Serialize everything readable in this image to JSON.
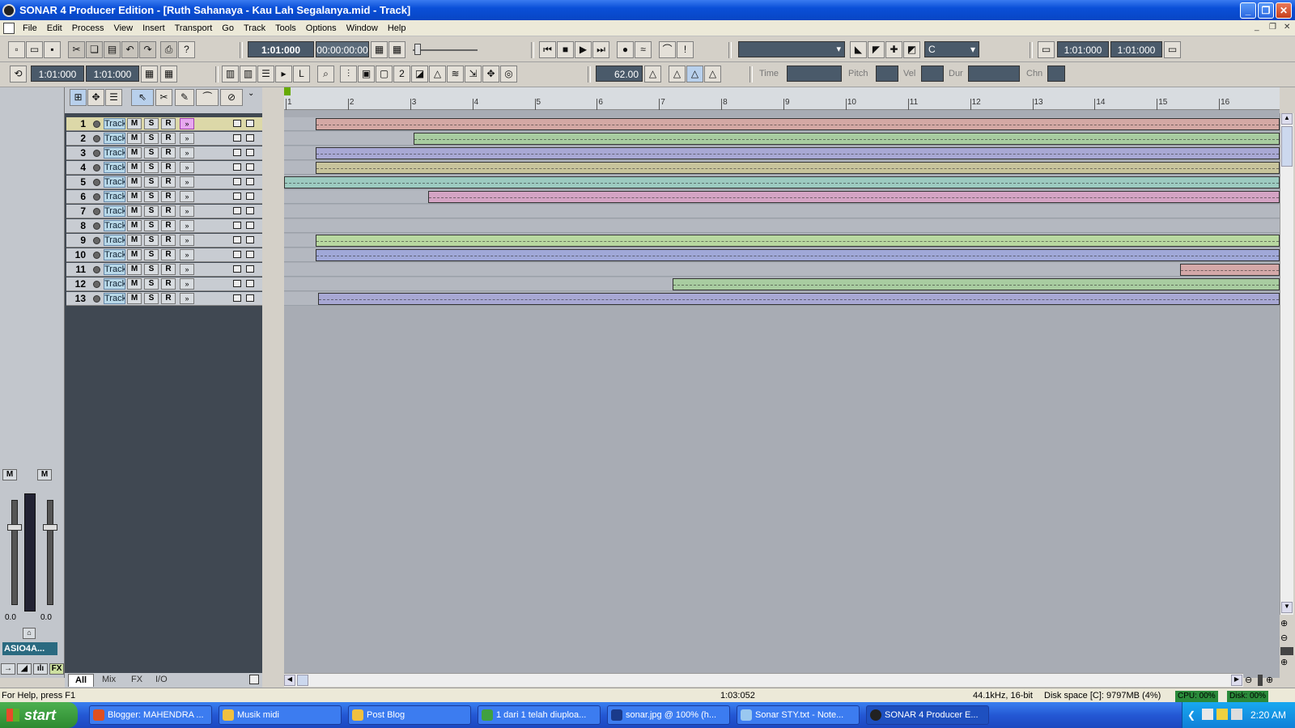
{
  "window": {
    "title": "SONAR 4 Producer Edition - [Ruth Sahanaya - Kau Lah Segalanya.mid - Track]"
  },
  "menu": [
    "File",
    "Edit",
    "Process",
    "View",
    "Insert",
    "Transport",
    "Go",
    "Track",
    "Tools",
    "Options",
    "Window",
    "Help"
  ],
  "transport": {
    "now_time": "1:01:000",
    "smpte": "00:00:00:00",
    "key": "C",
    "loop_start": "1:01:000",
    "loop_end": "1:01:000"
  },
  "loop": {
    "start": "1:01:000",
    "end": "1:01:000"
  },
  "tempo": "62.00",
  "event_inspector": {
    "time_label": "Time",
    "pitch_label": "Pitch",
    "vel_label": "Vel",
    "dur_label": "Dur",
    "chn_label": "Chn"
  },
  "ruler": [
    "1",
    "2",
    "3",
    "4",
    "5",
    "6",
    "7",
    "8",
    "9",
    "10",
    "11",
    "12",
    "13",
    "14",
    "15",
    "16"
  ],
  "tracks": [
    {
      "num": "1",
      "name": "Track 1",
      "color": "#d4a8a4",
      "clip_start": 0.032,
      "clip_end": 1.0,
      "selected": true
    },
    {
      "num": "2",
      "name": "Track 2",
      "color": "#a8cca0",
      "clip_start": 0.13,
      "clip_end": 1.0
    },
    {
      "num": "3",
      "name": "Track 3",
      "color": "#a8a8d4",
      "clip_start": 0.032,
      "clip_end": 1.0
    },
    {
      "num": "4",
      "name": "Track 4",
      "color": "#c8c49c",
      "clip_start": 0.032,
      "clip_end": 1.0
    },
    {
      "num": "5",
      "name": "Track 5",
      "color": "#9ccac0",
      "clip_start": 0.0,
      "clip_end": 1.0
    },
    {
      "num": "6",
      "name": "Track 6",
      "color": "#d4a4c4",
      "clip_start": 0.145,
      "clip_end": 1.0
    },
    {
      "num": "7",
      "name": "Track 7",
      "color": "",
      "clip_start": null,
      "clip_end": null
    },
    {
      "num": "8",
      "name": "Track 8",
      "color": "",
      "clip_start": null,
      "clip_end": null
    },
    {
      "num": "9",
      "name": "Track 9",
      "color": "#b8d8a0",
      "clip_start": 0.032,
      "clip_end": 1.0
    },
    {
      "num": "10",
      "name": "Track 10",
      "color": "#a0a8d8",
      "clip_start": 0.032,
      "clip_end": 1.0
    },
    {
      "num": "11",
      "name": "Track 11",
      "color": "#d4a8a8",
      "clip_start": 0.9,
      "clip_end": 1.0
    },
    {
      "num": "12",
      "name": "Track 12",
      "color": "#a8cca0",
      "clip_start": 0.39,
      "clip_end": 1.0
    },
    {
      "num": "13",
      "name": "Track 13",
      "color": "#a8a8d4",
      "clip_start": 0.034,
      "clip_end": 1.0
    }
  ],
  "track_buttons": {
    "mute": "M",
    "solo": "S",
    "rec": "R"
  },
  "mixer": {
    "left_vol": "0.0",
    "right_vol": "0.0",
    "mute_l": "M",
    "mute_r": "M",
    "driver": "ASIO4A..."
  },
  "view_tabs": [
    "All",
    "Mix",
    "FX",
    "I/O"
  ],
  "status": {
    "help": "For Help, press F1",
    "position": "1:03:052",
    "format": "44.1kHz, 16-bit",
    "disk_space": "Disk space [C]: 9797MB (4%)",
    "cpu": "CPU: 00%",
    "disk": "Disk: 00%"
  },
  "taskbar": {
    "start": "start",
    "items": [
      "Blogger: MAHENDRA ...",
      "Musik midi",
      "Post Blog",
      "1 dari 1 telah diuploa...",
      "sonar.jpg @ 100% (h...",
      "Sonar STY.txt - Note...",
      "SONAR 4 Producer E..."
    ],
    "clock": "2:20 AM"
  }
}
